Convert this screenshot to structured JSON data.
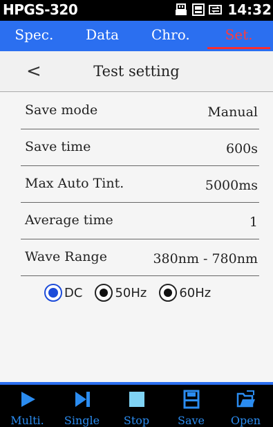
{
  "status": {
    "device": "HPGS-320",
    "time": "14:32",
    "icons": [
      "usb-icon",
      "sd-card-icon",
      "battery-icon"
    ]
  },
  "tabs": [
    {
      "label": "Spec.",
      "active": false
    },
    {
      "label": "Data",
      "active": false
    },
    {
      "label": "Chro.",
      "active": false
    },
    {
      "label": "Set.",
      "active": true
    }
  ],
  "header": {
    "title": "Test setting",
    "back": "<"
  },
  "settings": [
    {
      "label": "Save mode",
      "value": "Manual"
    },
    {
      "label": "Save time",
      "value": "600s"
    },
    {
      "label": "Max Auto Tint.",
      "value": "5000ms"
    },
    {
      "label": "Average time",
      "value": "1"
    },
    {
      "label": "Wave Range",
      "value": "380nm - 780nm"
    }
  ],
  "frequency": {
    "options": [
      "DC",
      "50Hz",
      "60Hz"
    ],
    "selected": "DC"
  },
  "toolbar": [
    {
      "label": "Multi.",
      "icon": "play-icon"
    },
    {
      "label": "Single",
      "icon": "step-forward-icon"
    },
    {
      "label": "Stop",
      "icon": "stop-icon"
    },
    {
      "label": "Save",
      "icon": "save-icon"
    },
    {
      "label": "Open",
      "icon": "folder-open-icon"
    }
  ],
  "colors": {
    "accent": "#2b6ff0",
    "active_tab": "#ff3b3b",
    "toolbar_text": "#2b8cf0"
  }
}
